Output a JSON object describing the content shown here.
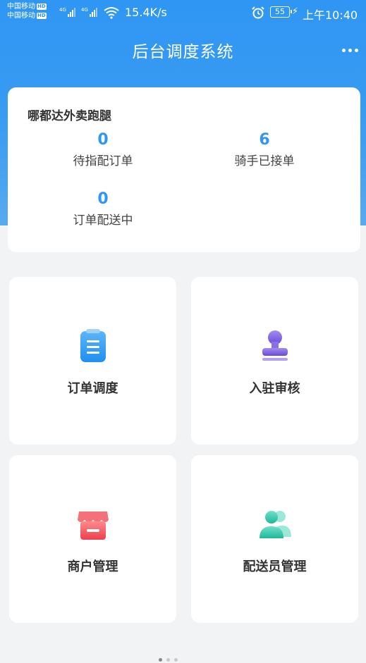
{
  "status_bar": {
    "carrier1": "中国移动",
    "carrier2": "中国移动",
    "hd_badge": "HD",
    "network_type": "4G",
    "net_speed": "15.4K/s",
    "battery": "55",
    "time": "上午10:40"
  },
  "header": {
    "title": "后台调度系统"
  },
  "summary": {
    "store_name": "哪都达外卖跑腿",
    "stats": [
      {
        "value": "0",
        "label": "待指配订单"
      },
      {
        "value": "6",
        "label": "骑手已接单"
      },
      {
        "value": "0",
        "label": "订单配送中"
      }
    ]
  },
  "tiles": [
    {
      "label": "订单调度",
      "icon": "clipboard-list-icon"
    },
    {
      "label": "入驻审核",
      "icon": "stamp-icon"
    },
    {
      "label": "商户管理",
      "icon": "storefront-icon"
    },
    {
      "label": "配送员管理",
      "icon": "users-icon"
    }
  ],
  "colors": {
    "primary": "#2f96f3",
    "order_icon": "#2b9af3",
    "review_icon": "#7b5ce0",
    "merchant_icon": "#f0505a",
    "courier_icon": "#2fc3a8"
  }
}
